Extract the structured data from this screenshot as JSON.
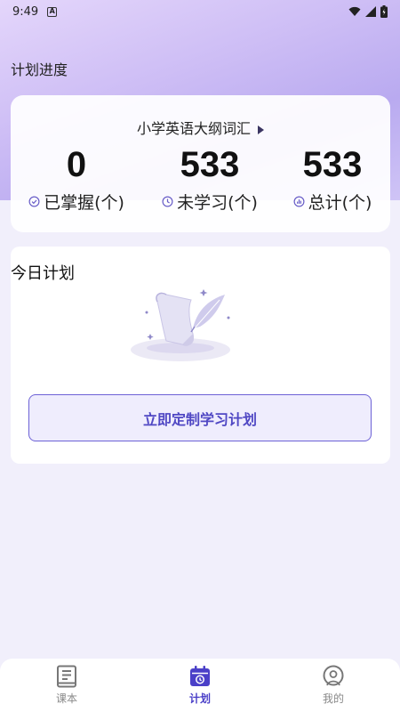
{
  "status_bar": {
    "time": "9:49",
    "notif_glyph": "A"
  },
  "page_title": "计划进度",
  "progress": {
    "book_name": "小学英语大纲词汇",
    "stats": [
      {
        "value": "0",
        "label": "已掌握(个)",
        "icon": "check-circle-icon"
      },
      {
        "value": "533",
        "label": "未学习(个)",
        "icon": "clock-icon"
      },
      {
        "value": "533",
        "label": "总计(个)",
        "icon": "chart-icon"
      }
    ]
  },
  "plan": {
    "title": "今日计划",
    "button_label": "立即定制学习计划"
  },
  "tabs": [
    {
      "label": "课本",
      "icon": "book-icon",
      "active": false
    },
    {
      "label": "计划",
      "icon": "calendar-icon",
      "active": true
    },
    {
      "label": "我的",
      "icon": "profile-icon",
      "active": false
    }
  ],
  "colors": {
    "accent": "#4b40c8",
    "button_bg": "#efedfd",
    "page_bg": "#f1effb"
  }
}
